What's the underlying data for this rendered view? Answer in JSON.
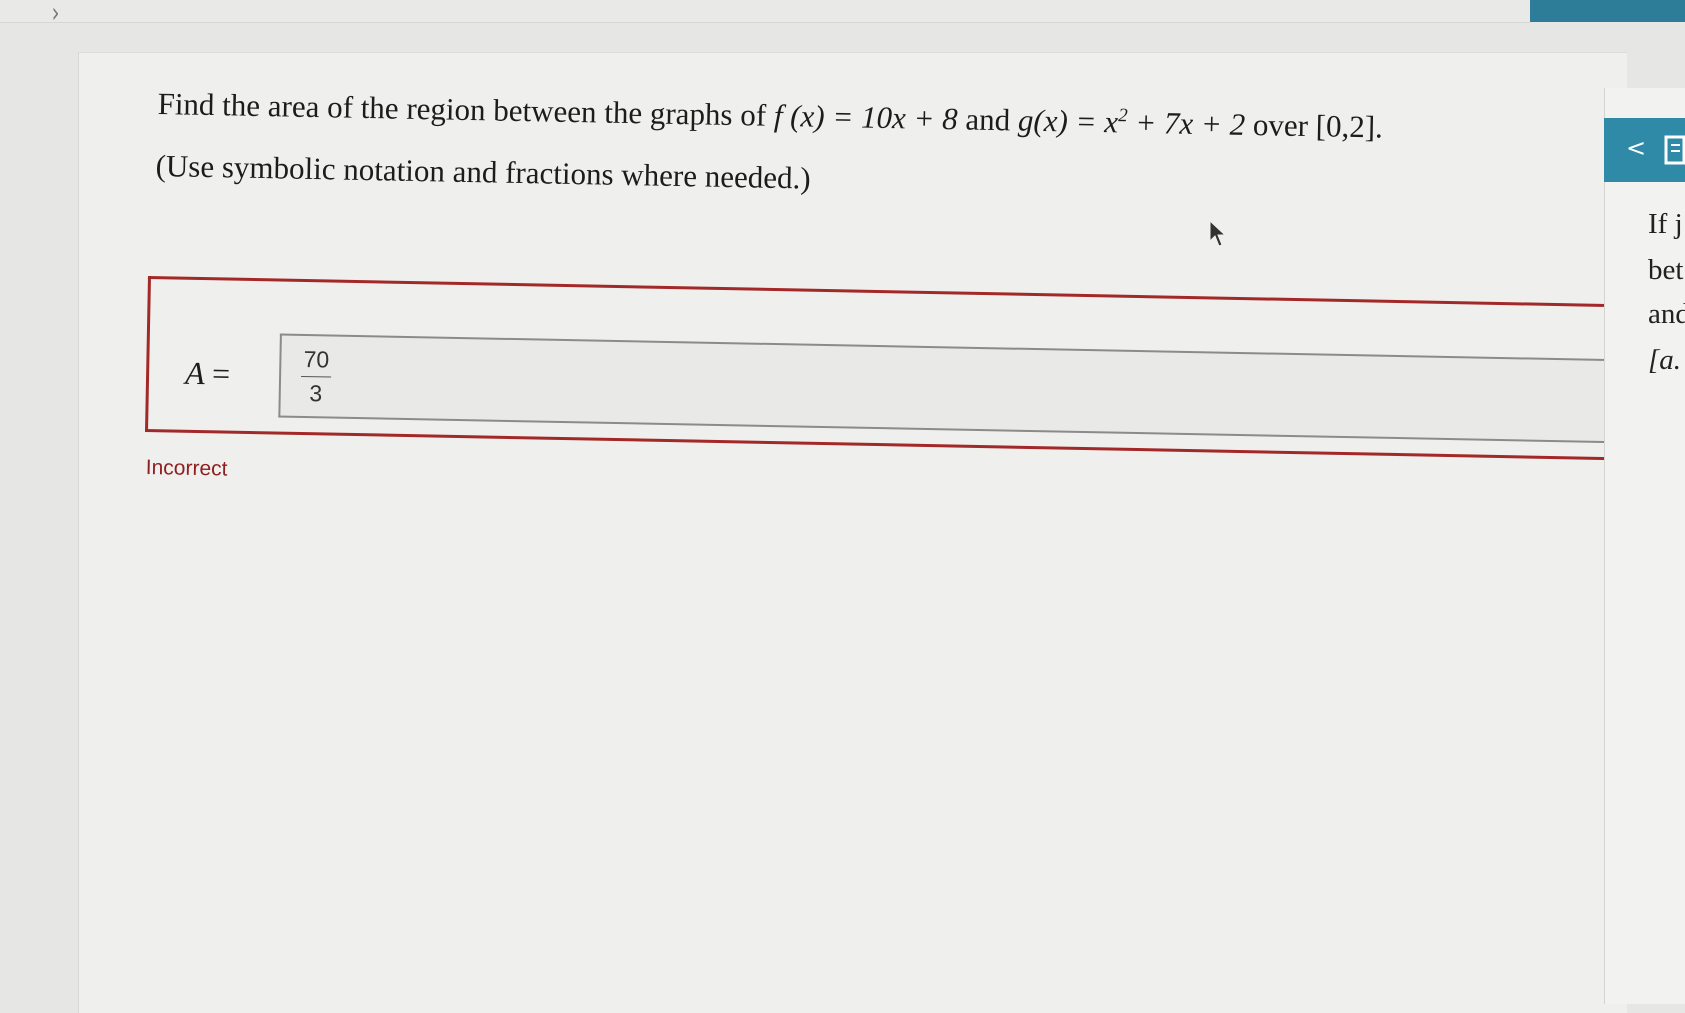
{
  "question": {
    "line1_prefix": "Find the area of the region between the graphs of ",
    "f_expr": "f (x) = 10x + 8",
    "and_text": " and ",
    "g_expr_pre": "g(x) = x",
    "g_expr_exp": "2",
    "g_expr_post": " + 7x + 2",
    "over_text": " over ",
    "interval": "[0,2].",
    "line2": "(Use symbolic notation and fractions where needed.)"
  },
  "answer": {
    "variable": "A",
    "equals": "=",
    "numerator": "70",
    "denominator": "3"
  },
  "feedback": {
    "status": "Incorrect",
    "color": "#a32828"
  },
  "side_panel": {
    "prev_label": "<",
    "icon": "book-icon",
    "text_lines": [
      "If j",
      "bet",
      "and",
      "[a."
    ]
  },
  "colors": {
    "accent": "#2e8aa6",
    "error": "#a32828"
  }
}
